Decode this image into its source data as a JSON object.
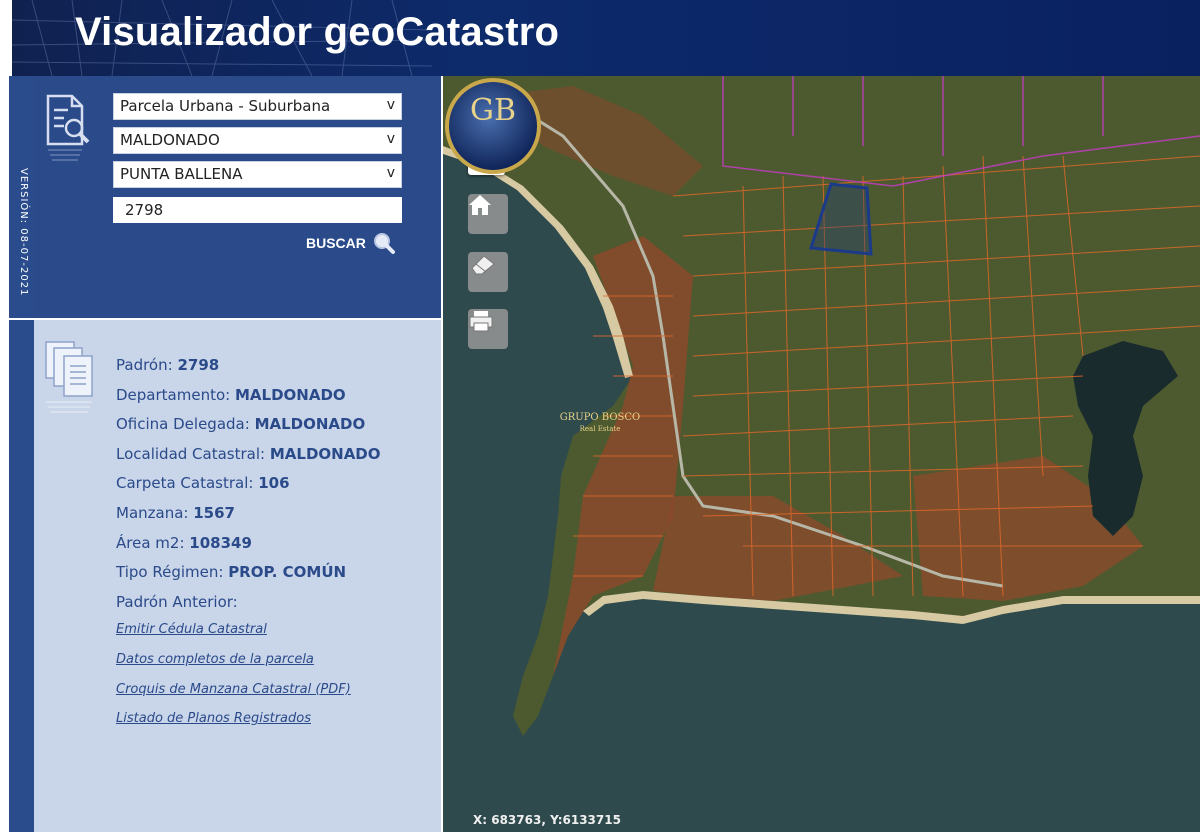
{
  "header": {
    "title": "Visualizador geoCatastro"
  },
  "version": "VERSIÓN: 08-07-2021",
  "search": {
    "tipo": "Parcela Urbana - Suburbana",
    "departamento": "MALDONADO",
    "localidad": "PUNTA BALLENA",
    "padron_value": "2798",
    "button_label": "BUSCAR",
    "chevron": "v"
  },
  "info": {
    "padron_label": "Padrón:",
    "padron": "2798",
    "departamento_label": "Departamento:",
    "departamento": "MALDONADO",
    "oficina_label": "Oficina Delegada:",
    "oficina": "MALDONADO",
    "localidad_label": "Localidad Catastral:",
    "localidad": "MALDONADO",
    "carpeta_label": "Carpeta Catastral:",
    "carpeta": "106",
    "manzana_label": "Manzana:",
    "manzana": "1567",
    "area_label": "Área m2:",
    "area": "108349",
    "regimen_label": "Tipo Régimen:",
    "regimen": "PROP. COMÚN",
    "anterior_label": "Padrón Anterior:",
    "links": [
      "Emitir Cédula Catastral",
      "Datos completos de la parcela",
      "Croquis de Manzana Catastral (PDF)",
      "Listado de Planos Registrados"
    ]
  },
  "map": {
    "zoom_in": "+",
    "zoom_out": "−",
    "coords": "X: 683763, Y:6133715",
    "logo_initials": "GB",
    "logo_name": "GRUPO BOSCO",
    "logo_sub": "Real Estate",
    "tools": [
      "home-icon",
      "eraser-icon",
      "print-icon"
    ]
  },
  "colors": {
    "header": "#0d2a6b",
    "panel": "#2a4a8a",
    "info_bg": "#c9d5e9",
    "parcel_line": "#e0682a",
    "selected_parcel": "#1b3a8a"
  }
}
